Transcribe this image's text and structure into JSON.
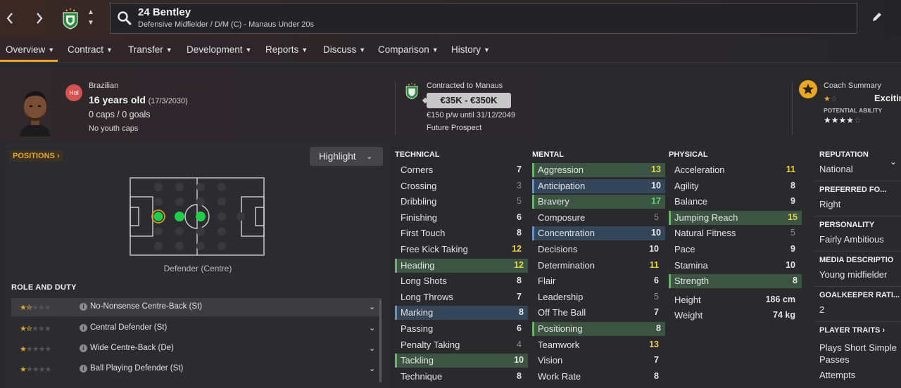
{
  "header": {
    "player_name": "24 Bentley",
    "player_subtitle": "Defensive Midfielder / D/M (C) - Manaus Under 20s"
  },
  "menu": {
    "items": [
      "Overview",
      "Contract",
      "Transfer",
      "Development",
      "Reports",
      "Discuss",
      "Comparison",
      "History"
    ],
    "active": "Overview"
  },
  "profile": {
    "nationality": "Brazilian",
    "hol_badge": "Hol",
    "age": "16 years old",
    "dob": "(17/3/2030)",
    "caps": "0 caps / 0 goals",
    "youth_caps": "No youth caps"
  },
  "contract": {
    "contracted_to": "Contracted to Manaus",
    "value_range": "€35K - €350K",
    "wage": "€150 p/w until 31/12/2049",
    "status": "Future Prospect"
  },
  "coach_summary": {
    "title": "Coach Summary",
    "text": "Excitin",
    "current_ability_stars": 1.5,
    "potential_label": "POTENTIAL ABILITY",
    "potential_ability_stars": 3.5
  },
  "positions": {
    "header": "POSITIONS",
    "highlight_label": "Highlight",
    "position_label": "Defender (Centre)"
  },
  "roles": {
    "header": "ROLE AND DUTY",
    "items": [
      {
        "name": "No-Nonsense Centre-Back (St)",
        "stars": 1.5
      },
      {
        "name": "Central Defender (St)",
        "stars": 1.5
      },
      {
        "name": "Wide Centre-Back (De)",
        "stars": 1
      },
      {
        "name": "Ball Playing Defender (St)",
        "stars": 1
      }
    ]
  },
  "attributes": {
    "technical_header": "TECHNICAL",
    "mental_header": "MENTAL",
    "physical_header": "PHYSICAL",
    "technical": [
      {
        "name": "Corners",
        "value": "7"
      },
      {
        "name": "Crossing",
        "value": "3"
      },
      {
        "name": "Dribbling",
        "value": "5"
      },
      {
        "name": "Finishing",
        "value": "6"
      },
      {
        "name": "First Touch",
        "value": "8"
      },
      {
        "name": "Free Kick Taking",
        "value": "12"
      },
      {
        "name": "Heading",
        "value": "12"
      },
      {
        "name": "Long Shots",
        "value": "8"
      },
      {
        "name": "Long Throws",
        "value": "7"
      },
      {
        "name": "Marking",
        "value": "8"
      },
      {
        "name": "Passing",
        "value": "6"
      },
      {
        "name": "Penalty Taking",
        "value": "4"
      },
      {
        "name": "Tackling",
        "value": "10"
      },
      {
        "name": "Technique",
        "value": "8"
      }
    ],
    "mental": [
      {
        "name": "Aggression",
        "value": "13"
      },
      {
        "name": "Anticipation",
        "value": "10"
      },
      {
        "name": "Bravery",
        "value": "17"
      },
      {
        "name": "Composure",
        "value": "5"
      },
      {
        "name": "Concentration",
        "value": "10"
      },
      {
        "name": "Decisions",
        "value": "10"
      },
      {
        "name": "Determination",
        "value": "11"
      },
      {
        "name": "Flair",
        "value": "6"
      },
      {
        "name": "Leadership",
        "value": "5"
      },
      {
        "name": "Off The Ball",
        "value": "7"
      },
      {
        "name": "Positioning",
        "value": "8"
      },
      {
        "name": "Teamwork",
        "value": "13"
      },
      {
        "name": "Vision",
        "value": "7"
      },
      {
        "name": "Work Rate",
        "value": "8"
      }
    ],
    "physical": [
      {
        "name": "Acceleration",
        "value": "11"
      },
      {
        "name": "Agility",
        "value": "8"
      },
      {
        "name": "Balance",
        "value": "9"
      },
      {
        "name": "Jumping Reach",
        "value": "15"
      },
      {
        "name": "Natural Fitness",
        "value": "5"
      },
      {
        "name": "Pace",
        "value": "9"
      },
      {
        "name": "Stamina",
        "value": "10"
      },
      {
        "name": "Strength",
        "value": "8"
      }
    ],
    "height_label": "Height",
    "height": "186 cm",
    "weight_label": "Weight",
    "weight": "74 kg"
  },
  "side_info": {
    "reputation_h": "REPUTATION",
    "reputation": "National",
    "foot_h": "PREFERRED FO...",
    "foot": "Right",
    "personality_h": "PERSONALITY",
    "personality": "Fairly Ambitious",
    "media_h": "MEDIA DESCRIPTIO",
    "media": "Young midfielder",
    "gk_h": "GOALKEEPER RATI...",
    "gk": "2",
    "traits_h": "PLAYER TRAITS",
    "trait_1a": "Plays Short Simple",
    "trait_1b": "Passes",
    "trait_2": "Attempts"
  },
  "colors": {
    "accent": "#e9a623",
    "highlight_green": "#3c5442",
    "highlight_blue": "#34475a",
    "value_yellow": "#e6d348",
    "value_green": "#5ed36a"
  }
}
